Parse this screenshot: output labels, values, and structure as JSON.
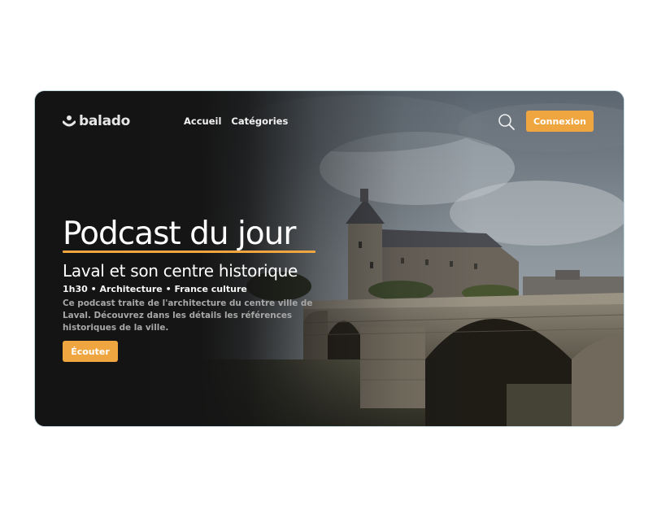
{
  "brand": {
    "name": "balado",
    "logo_icon": "podcast-listener-icon"
  },
  "nav": {
    "items": [
      {
        "label": "Accueil"
      },
      {
        "label": "Catégories"
      }
    ]
  },
  "header": {
    "search_icon": "search-icon",
    "login_label": "Connexion"
  },
  "hero": {
    "title": "Podcast du jour",
    "episode_title": "Laval et son centre historique",
    "meta": "1h30 • Architecture • France culture",
    "description": "Ce podcast traite de l'architecture du centre ville de Laval. Découvrez dans les détails les références historiques de la ville.",
    "listen_label": "Écouter",
    "background_image": "stone bridge and castle photograph"
  },
  "colors": {
    "accent": "#f0a640",
    "dark_background": "#151515",
    "text_primary": "#ffffff",
    "text_muted": "#a7a7a7"
  }
}
